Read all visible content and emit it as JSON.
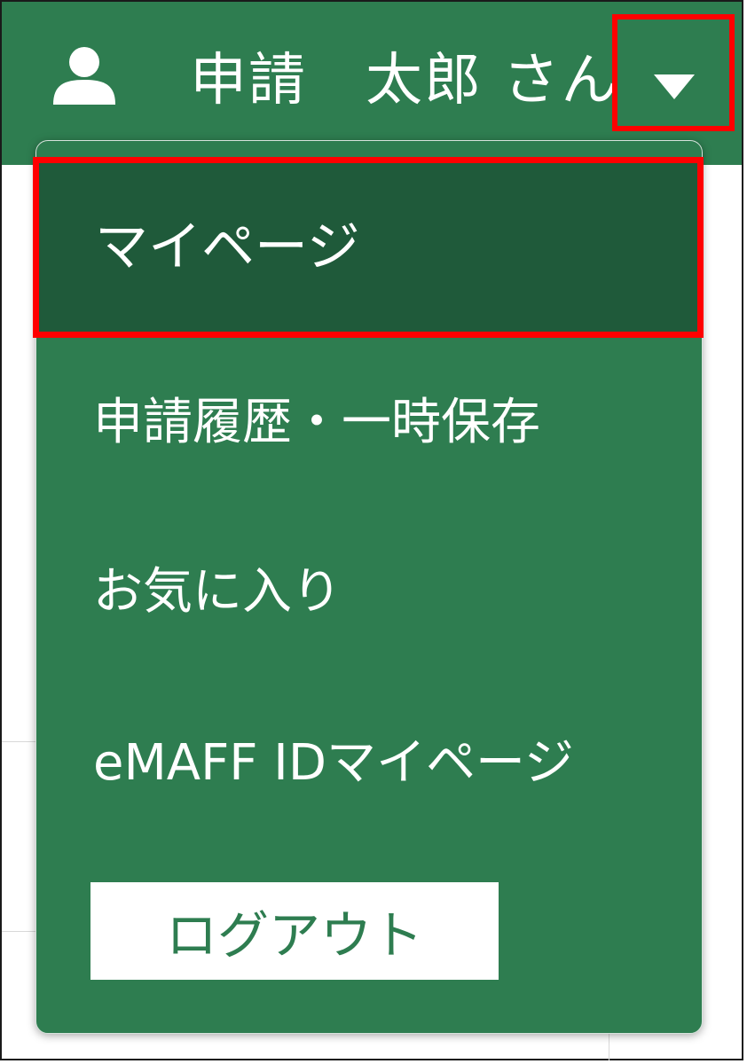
{
  "header": {
    "user_icon": "user-icon",
    "user_name": "申請　太郎 さん",
    "toggle_icon": "caret-down-icon",
    "background_color": "#2e7d50"
  },
  "menu": {
    "items": [
      {
        "label": "マイページ",
        "active": true
      },
      {
        "label": "申請履歴・一時保存",
        "active": false
      },
      {
        "label": "お気に入り",
        "active": false
      },
      {
        "label": "eMAFF IDマイページ",
        "active": false
      }
    ],
    "logout_label": "ログアウト",
    "active_background": "#1f5a3a",
    "highlight_color": "#ff0000"
  }
}
